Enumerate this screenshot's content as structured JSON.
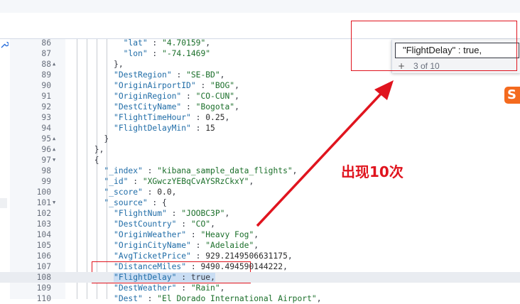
{
  "editor": {
    "lines": [
      {
        "n": "86",
        "fold": "",
        "parts": [
          {
            "t": "            \"lat\"",
            "c": "key"
          },
          {
            "t": " : ",
            "c": "punct"
          },
          {
            "t": "\"4.70159\"",
            "c": "str"
          },
          {
            "t": ",",
            "c": "punct"
          }
        ]
      },
      {
        "n": "87",
        "fold": "",
        "parts": [
          {
            "t": "            \"lon\"",
            "c": "key"
          },
          {
            "t": " : ",
            "c": "punct"
          },
          {
            "t": "\"-74.1469\"",
            "c": "str"
          }
        ]
      },
      {
        "n": "88",
        "fold": "▲",
        "parts": [
          {
            "t": "          },",
            "c": "punct"
          }
        ]
      },
      {
        "n": "89",
        "fold": "",
        "parts": [
          {
            "t": "          \"DestRegion\"",
            "c": "key"
          },
          {
            "t": " : ",
            "c": "punct"
          },
          {
            "t": "\"SE-BD\"",
            "c": "str"
          },
          {
            "t": ",",
            "c": "punct"
          }
        ]
      },
      {
        "n": "90",
        "fold": "",
        "parts": [
          {
            "t": "          \"OriginAirportID\"",
            "c": "key"
          },
          {
            "t": " : ",
            "c": "punct"
          },
          {
            "t": "\"BOG\"",
            "c": "str"
          },
          {
            "t": ",",
            "c": "punct"
          }
        ]
      },
      {
        "n": "91",
        "fold": "",
        "parts": [
          {
            "t": "          \"OriginRegion\"",
            "c": "key"
          },
          {
            "t": " : ",
            "c": "punct"
          },
          {
            "t": "\"CO-CUN\"",
            "c": "str"
          },
          {
            "t": ",",
            "c": "punct"
          }
        ]
      },
      {
        "n": "92",
        "fold": "",
        "parts": [
          {
            "t": "          \"DestCityName\"",
            "c": "key"
          },
          {
            "t": " : ",
            "c": "punct"
          },
          {
            "t": "\"Bogota\"",
            "c": "str"
          },
          {
            "t": ",",
            "c": "punct"
          }
        ]
      },
      {
        "n": "93",
        "fold": "",
        "parts": [
          {
            "t": "          \"FlightTimeHour\"",
            "c": "key"
          },
          {
            "t": " : ",
            "c": "punct"
          },
          {
            "t": "0.25",
            "c": "num"
          },
          {
            "t": ",",
            "c": "punct"
          }
        ]
      },
      {
        "n": "94",
        "fold": "",
        "parts": [
          {
            "t": "          \"FlightDelayMin\"",
            "c": "key"
          },
          {
            "t": " : ",
            "c": "punct"
          },
          {
            "t": "15",
            "c": "num"
          }
        ]
      },
      {
        "n": "95",
        "fold": "▲",
        "parts": [
          {
            "t": "        }",
            "c": "punct"
          }
        ]
      },
      {
        "n": "96",
        "fold": "▲",
        "parts": [
          {
            "t": "      },",
            "c": "punct"
          }
        ]
      },
      {
        "n": "97",
        "fold": "▼",
        "parts": [
          {
            "t": "      {",
            "c": "punct"
          }
        ]
      },
      {
        "n": "98",
        "fold": "",
        "parts": [
          {
            "t": "        \"_index\"",
            "c": "key"
          },
          {
            "t": " : ",
            "c": "punct"
          },
          {
            "t": "\"kibana_sample_data_flights\"",
            "c": "str"
          },
          {
            "t": ",",
            "c": "punct"
          }
        ]
      },
      {
        "n": "99",
        "fold": "",
        "parts": [
          {
            "t": "        \"_id\"",
            "c": "key"
          },
          {
            "t": " : ",
            "c": "punct"
          },
          {
            "t": "\"XGwczYEBqCvAYSRzCkxY\"",
            "c": "str"
          },
          {
            "t": ",",
            "c": "punct"
          }
        ]
      },
      {
        "n": "100",
        "fold": "",
        "parts": [
          {
            "t": "        \"_score\"",
            "c": "key"
          },
          {
            "t": " : ",
            "c": "punct"
          },
          {
            "t": "0.0",
            "c": "num"
          },
          {
            "t": ",",
            "c": "punct"
          }
        ]
      },
      {
        "n": "101",
        "fold": "▼",
        "parts": [
          {
            "t": "        \"_source\"",
            "c": "key"
          },
          {
            "t": " : {",
            "c": "punct"
          }
        ]
      },
      {
        "n": "102",
        "fold": "",
        "parts": [
          {
            "t": "          \"FlightNum\"",
            "c": "key"
          },
          {
            "t": " : ",
            "c": "punct"
          },
          {
            "t": "\"JOOBC3P\"",
            "c": "str"
          },
          {
            "t": ",",
            "c": "punct"
          }
        ]
      },
      {
        "n": "103",
        "fold": "",
        "parts": [
          {
            "t": "          \"DestCountry\"",
            "c": "key"
          },
          {
            "t": " : ",
            "c": "punct"
          },
          {
            "t": "\"CO\"",
            "c": "str"
          },
          {
            "t": ",",
            "c": "punct"
          }
        ]
      },
      {
        "n": "104",
        "fold": "",
        "parts": [
          {
            "t": "          \"OriginWeather\"",
            "c": "key"
          },
          {
            "t": " : ",
            "c": "punct"
          },
          {
            "t": "\"Heavy Fog\"",
            "c": "str"
          },
          {
            "t": ",",
            "c": "punct"
          }
        ]
      },
      {
        "n": "105",
        "fold": "",
        "parts": [
          {
            "t": "          \"OriginCityName\"",
            "c": "key"
          },
          {
            "t": " : ",
            "c": "punct"
          },
          {
            "t": "\"Adelaide\"",
            "c": "str"
          },
          {
            "t": ",",
            "c": "punct"
          }
        ]
      },
      {
        "n": "106",
        "fold": "",
        "parts": [
          {
            "t": "          \"AvgTicketPrice\"",
            "c": "key"
          },
          {
            "t": " : ",
            "c": "punct"
          },
          {
            "t": "929.2149506631175",
            "c": "num"
          },
          {
            "t": ",",
            "c": "punct"
          }
        ]
      },
      {
        "n": "107",
        "fold": "",
        "parts": [
          {
            "t": "          \"DistanceMiles\"",
            "c": "key"
          },
          {
            "t": " : ",
            "c": "punct"
          },
          {
            "t": "9490.494590144222",
            "c": "num"
          },
          {
            "t": ",",
            "c": "punct"
          }
        ]
      },
      {
        "n": "108",
        "fold": "",
        "active": true,
        "parts": [
          {
            "t": "          ",
            "c": "punct"
          },
          {
            "t": "\"FlightDelay\"",
            "c": "key",
            "hl": true
          },
          {
            "t": " : ",
            "c": "punct",
            "hl": true
          },
          {
            "t": "true",
            "c": "boolv",
            "hl": true
          },
          {
            "t": ",",
            "c": "punct",
            "hl": true
          }
        ]
      },
      {
        "n": "109",
        "fold": "",
        "parts": [
          {
            "t": "          \"DestWeather\"",
            "c": "key"
          },
          {
            "t": " : ",
            "c": "punct"
          },
          {
            "t": "\"Rain\"",
            "c": "str"
          },
          {
            "t": ",",
            "c": "punct"
          }
        ]
      },
      {
        "n": "110",
        "fold": "",
        "parts": [
          {
            "t": "          \"Dest\"",
            "c": "key"
          },
          {
            "t": " : ",
            "c": "punct"
          },
          {
            "t": "\"El Dorado International Airport\"",
            "c": "str"
          },
          {
            "t": ",",
            "c": "punct"
          }
        ]
      }
    ]
  },
  "find": {
    "query": "\"FlightDelay\" : true,",
    "toggle_label": "+",
    "match_count": "3 of 10"
  },
  "annotation": {
    "text": "出现10次",
    "color": "#e0141e"
  },
  "sogou": {
    "letter": "S"
  }
}
